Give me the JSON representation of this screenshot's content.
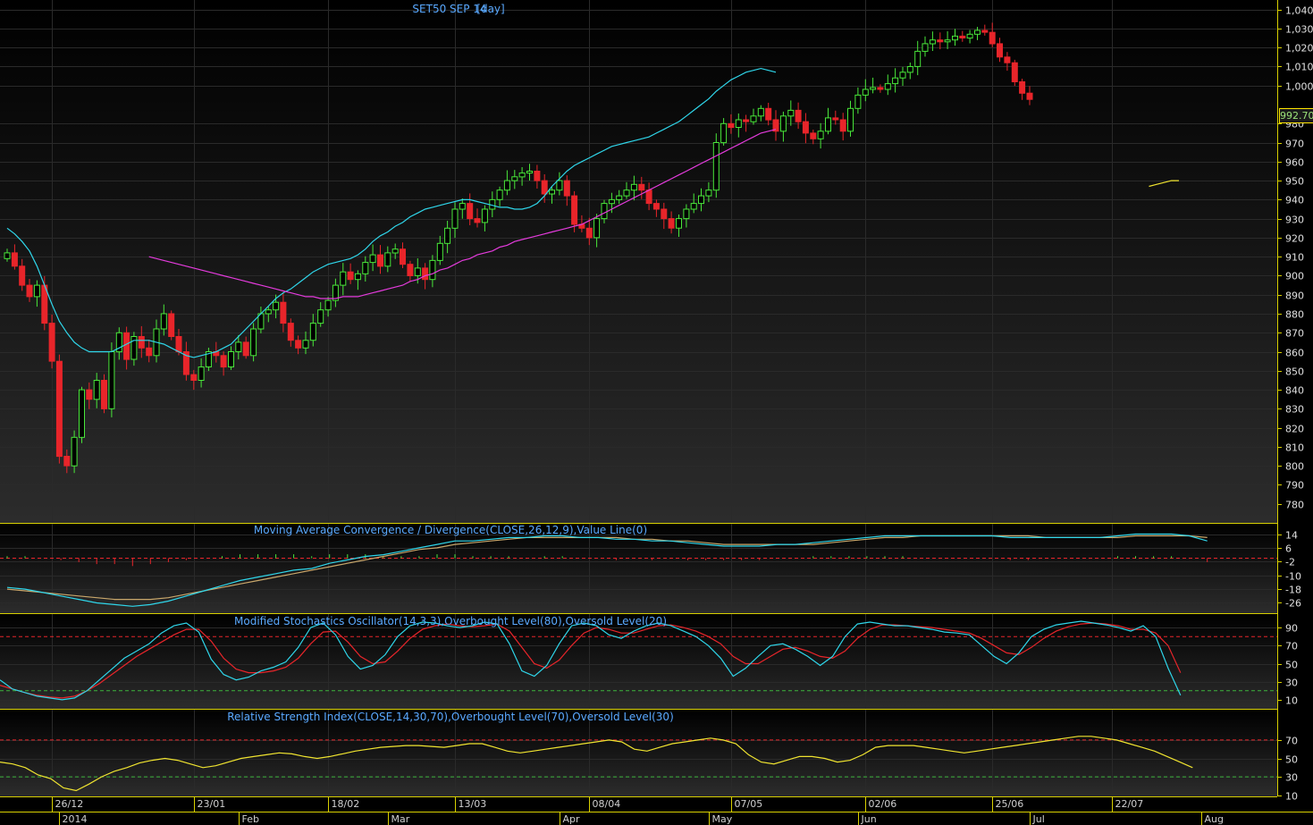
{
  "chart_data": {
    "type": "candlestick",
    "title": "SET50 SEP 14",
    "interval": "[day]",
    "last_price_label": "992.70",
    "colors": {
      "up": "#49e83a",
      "down": "#e8252a",
      "ma_short": "#2fd6ea",
      "ma_medium": "#e43bdc",
      "ma_long": "#f0e430",
      "macd_line": "#2fd6ea",
      "macd_signal": "#c9a76b",
      "stoch_k": "#2fd6ea",
      "stoch_d": "#e8252a",
      "rsi": "#f0e430",
      "label": "#5aa9ff"
    },
    "price_panel": {
      "ylim": [
        770,
        1045
      ],
      "yticks": [
        780,
        790,
        800,
        810,
        820,
        830,
        840,
        850,
        860,
        870,
        880,
        890,
        900,
        910,
        920,
        930,
        940,
        950,
        960,
        970,
        980,
        1000,
        1010,
        1020,
        1030,
        1040
      ],
      "ytick_labels": [
        "780",
        "790",
        "800",
        "810",
        "820",
        "830",
        "840",
        "850",
        "860",
        "870",
        "880",
        "890",
        "900",
        "910",
        "920",
        "930",
        "940",
        "950",
        "960",
        "970",
        "980",
        "1,000",
        "1,010",
        "1,020",
        "1,030",
        "1,040"
      ],
      "closes": [
        912,
        905,
        895,
        889,
        895,
        875,
        855,
        805,
        800,
        815,
        840,
        835,
        845,
        830,
        860,
        870,
        856,
        868,
        862,
        858,
        872,
        880,
        868,
        860,
        848,
        845,
        852,
        860,
        858,
        852,
        860,
        865,
        858,
        872,
        880,
        882,
        886,
        875,
        866,
        862,
        866,
        875,
        882,
        887,
        895,
        902,
        898,
        901,
        907,
        911,
        905,
        912,
        914,
        906,
        900,
        904,
        898,
        908,
        917,
        925,
        935,
        938,
        930,
        928,
        935,
        940,
        945,
        950,
        952,
        954,
        955,
        950,
        943,
        945,
        950,
        942,
        927,
        925,
        920,
        930,
        938,
        940,
        942,
        945,
        948,
        945,
        938,
        935,
        930,
        925,
        930,
        935,
        938,
        942,
        945,
        970,
        980,
        978,
        982,
        981,
        984,
        988,
        982,
        976,
        984,
        987,
        981,
        975,
        972,
        976,
        983,
        982,
        976,
        988,
        995,
        998,
        999,
        998,
        1001,
        1004,
        1007,
        1010,
        1018,
        1022,
        1024,
        1023,
        1024,
        1026,
        1025,
        1027,
        1029,
        1028,
        1022,
        1015,
        1012,
        1002,
        996,
        992.7
      ],
      "ma_short": [
        925,
        922,
        918,
        913,
        905,
        895,
        885,
        876,
        870,
        865,
        862,
        860,
        860,
        860,
        860,
        862,
        864,
        866,
        866,
        866,
        865,
        864,
        862,
        860,
        858,
        857,
        858,
        859,
        860,
        862,
        864,
        868,
        872,
        876,
        880,
        884,
        888,
        891,
        893,
        896,
        899,
        902,
        904,
        906,
        907,
        908,
        909,
        911,
        914,
        918,
        921,
        923,
        926,
        928,
        931,
        933,
        935,
        936,
        937,
        938,
        939,
        940,
        940,
        939,
        938,
        937,
        936,
        936,
        935,
        935,
        936,
        938,
        942,
        947,
        951,
        955,
        958,
        960,
        962,
        964,
        966,
        968,
        969,
        970,
        971,
        972,
        973,
        975,
        977,
        979,
        981,
        984,
        987,
        990,
        993,
        997,
        1000,
        1003,
        1005,
        1007,
        1008,
        1009,
        1008,
        1007
      ],
      "ma_medium": [
        910,
        909,
        908,
        907,
        906,
        905,
        904,
        903,
        902,
        901,
        900,
        899,
        898,
        897,
        896,
        895,
        894,
        893,
        892,
        891,
        890,
        889,
        889,
        888,
        888,
        888,
        889,
        889,
        889,
        890,
        891,
        892,
        893,
        894,
        895,
        897,
        898,
        900,
        901,
        903,
        904,
        906,
        908,
        909,
        911,
        912,
        913,
        915,
        916,
        918,
        919,
        920,
        921,
        922,
        923,
        924,
        925,
        926,
        927,
        929,
        931,
        933,
        935,
        937,
        939,
        941,
        943,
        945,
        947,
        949,
        951,
        953,
        955,
        957,
        959,
        961,
        963,
        965,
        967,
        969,
        971,
        973,
        975,
        976,
        977
      ],
      "ma_long": [
        947,
        948,
        949,
        950,
        950
      ]
    },
    "macd_panel": {
      "label": "Moving Average Convergence / Divergence(CLOSE,26,12,9),Value Line(0)",
      "yticks": [
        14,
        6,
        -2,
        -10,
        -18,
        -26
      ],
      "ytick_labels": [
        "14",
        "6",
        "-2",
        "-10",
        "-18",
        "-26"
      ],
      "ylim": [
        -32,
        20
      ],
      "macd": [
        -17,
        -18,
        -20,
        -22,
        -24,
        -26,
        -27,
        -28,
        -27,
        -25,
        -22,
        -19,
        -16,
        -13,
        -11,
        -9,
        -7,
        -6,
        -3,
        -1,
        1,
        2,
        4,
        6,
        8,
        10,
        10,
        11,
        12,
        12,
        13,
        13,
        12,
        12,
        11,
        11,
        10,
        10,
        9,
        8,
        7,
        7,
        7,
        8,
        8,
        9,
        10,
        11,
        12,
        13,
        13,
        13,
        13,
        13,
        13,
        13,
        12,
        12,
        12,
        12,
        12,
        12,
        13,
        14,
        14,
        14,
        13,
        10
      ],
      "signal": [
        -18,
        -19,
        -20,
        -21,
        -22,
        -23,
        -24,
        -24,
        -24,
        -23,
        -21,
        -19,
        -17,
        -15,
        -13,
        -11,
        -9,
        -7,
        -5,
        -3,
        -1,
        1,
        3,
        5,
        6,
        8,
        9,
        10,
        11,
        12,
        12,
        12,
        12,
        12,
        12,
        11,
        11,
        10,
        10,
        9,
        8,
        8,
        8,
        8,
        8,
        8,
        9,
        10,
        11,
        12,
        12,
        13,
        13,
        13,
        13,
        13,
        13,
        13,
        12,
        12,
        12,
        12,
        12,
        13,
        13,
        13,
        13,
        12
      ]
    },
    "stoch_panel": {
      "label": "Modified Stochastics Oscillator(14,3,3),Overbought Level(80),Oversold Level(20)",
      "yticks": [
        90,
        70,
        50,
        30,
        10
      ],
      "ytick_labels": [
        "90",
        "70",
        "50",
        "30",
        "10"
      ],
      "overbought": 80,
      "oversold": 20,
      "k": [
        32,
        22,
        18,
        14,
        12,
        10,
        12,
        20,
        32,
        44,
        56,
        64,
        72,
        84,
        92,
        95,
        85,
        55,
        38,
        32,
        35,
        42,
        46,
        52,
        68,
        90,
        95,
        82,
        58,
        44,
        48,
        60,
        80,
        92,
        96,
        95,
        92,
        90,
        92,
        96,
        94,
        72,
        42,
        36,
        48,
        72,
        92,
        95,
        92,
        82,
        78,
        86,
        92,
        95,
        92,
        86,
        80,
        70,
        56,
        36,
        45,
        58,
        70,
        72,
        66,
        58,
        48,
        58,
        80,
        94,
        96,
        94,
        92,
        92,
        90,
        88,
        85,
        84,
        82,
        70,
        58,
        50,
        62,
        80,
        88,
        93,
        95,
        97,
        95,
        93,
        90,
        86,
        92,
        80,
        45,
        15
      ],
      "d": [
        26,
        22,
        18,
        15,
        13,
        12,
        14,
        20,
        28,
        38,
        48,
        58,
        66,
        74,
        82,
        88,
        88,
        75,
        56,
        44,
        40,
        40,
        42,
        46,
        56,
        72,
        85,
        86,
        74,
        58,
        50,
        52,
        64,
        78,
        88,
        92,
        94,
        92,
        91,
        92,
        94,
        86,
        68,
        50,
        45,
        54,
        70,
        84,
        90,
        88,
        84,
        84,
        88,
        92,
        93,
        90,
        86,
        80,
        72,
        58,
        50,
        50,
        58,
        66,
        68,
        64,
        58,
        56,
        64,
        78,
        88,
        93,
        93,
        92,
        91,
        90,
        88,
        86,
        84,
        78,
        70,
        62,
        60,
        68,
        78,
        86,
        91,
        94,
        95,
        94,
        92,
        88,
        88,
        84,
        70,
        40
      ]
    },
    "rsi_panel": {
      "label": "Relative Strength Index(CLOSE,14,30,70),Overbought Level(70),Oversold Level(30)",
      "yticks": [
        70,
        50,
        30,
        10
      ],
      "ytick_labels": [
        "70",
        "50",
        "30",
        "10"
      ],
      "overbought": 70,
      "oversold": 30,
      "values": [
        46,
        44,
        40,
        32,
        28,
        18,
        15,
        22,
        30,
        36,
        40,
        45,
        48,
        50,
        48,
        44,
        40,
        42,
        46,
        50,
        52,
        54,
        56,
        55,
        52,
        50,
        52,
        55,
        58,
        60,
        62,
        63,
        64,
        64,
        63,
        62,
        64,
        66,
        66,
        62,
        58,
        56,
        58,
        60,
        62,
        64,
        66,
        68,
        70,
        68,
        60,
        58,
        62,
        66,
        68,
        70,
        72,
        70,
        66,
        54,
        46,
        44,
        48,
        52,
        52,
        50,
        46,
        48,
        54,
        62,
        64,
        64,
        64,
        62,
        60,
        58,
        56,
        58,
        60,
        62,
        64,
        66,
        68,
        70,
        72,
        74,
        74,
        72,
        70,
        66,
        62,
        58,
        52,
        46,
        40
      ]
    },
    "x_axis": {
      "date_labels": [
        {
          "text": "26/12",
          "i": 6
        },
        {
          "text": "23/01",
          "i": 25
        },
        {
          "text": "18/02",
          "i": 43
        },
        {
          "text": "13/03",
          "i": 60
        },
        {
          "text": "08/04",
          "i": 78
        },
        {
          "text": "07/05",
          "i": 97
        },
        {
          "text": "02/06",
          "i": 115
        },
        {
          "text": "25/06",
          "i": 132
        },
        {
          "text": "22/07",
          "i": 148
        }
      ],
      "month_labels": [
        {
          "text": "2014",
          "i": 7
        },
        {
          "text": "Feb",
          "i": 31
        },
        {
          "text": "Mar",
          "i": 51
        },
        {
          "text": "Apr",
          "i": 74
        },
        {
          "text": "May",
          "i": 94
        },
        {
          "text": "Jun",
          "i": 114
        },
        {
          "text": "Jul",
          "i": 137
        },
        {
          "text": "Aug",
          "i": 160
        }
      ]
    }
  }
}
